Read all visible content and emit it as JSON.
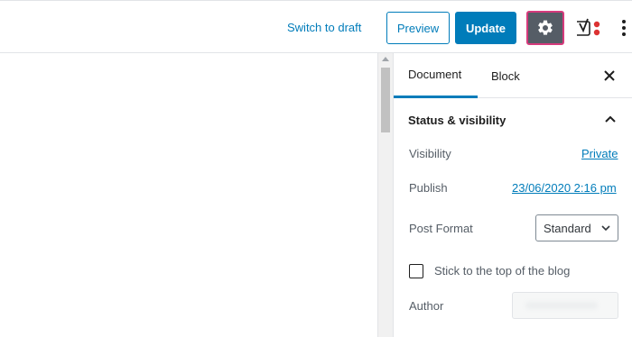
{
  "toolbar": {
    "switch_to_draft": "Switch to draft",
    "preview": "Preview",
    "update": "Update",
    "settings_icon": "gear-icon",
    "yoast_icon": "yoast-icon",
    "more_icon": "vertical-ellipsis-icon"
  },
  "sidebar": {
    "tabs": [
      {
        "label": "Document",
        "active": true
      },
      {
        "label": "Block",
        "active": false
      }
    ],
    "close_icon": "close-icon",
    "panel": {
      "title": "Status & visibility",
      "visibility_label": "Visibility",
      "visibility_value": "Private",
      "publish_label": "Publish",
      "publish_value": "23/06/2020 2:16 pm",
      "post_format_label": "Post Format",
      "post_format_value": "Standard",
      "sticky_label": "Stick to the top of the blog",
      "sticky_checked": false,
      "author_label": "Author"
    }
  },
  "colors": {
    "accent": "#007cba",
    "settings_bg": "#555d66",
    "settings_border": "#d63a7c",
    "yoast_dot": "#dc3232"
  }
}
